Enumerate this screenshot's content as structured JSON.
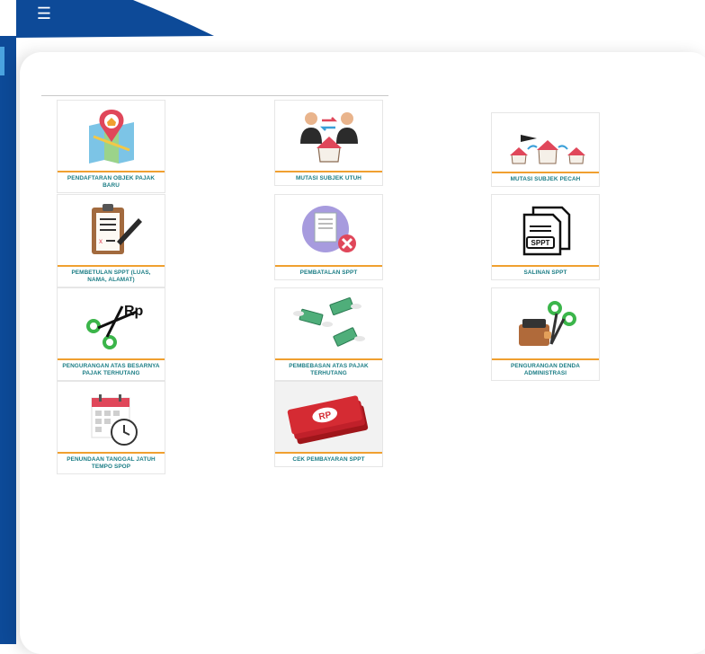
{
  "header": {
    "menu_icon": "hamburger-menu-icon"
  },
  "colors": {
    "sidebar": "#0d4a98",
    "accent": "#f0a030",
    "label_text": "#1b7d85"
  },
  "menu_tiles": [
    {
      "id": "pendaftaran-objek-pajak-baru",
      "label": "PENDAFTARAN OBJEK PAJAK BARU",
      "icon": "map-pin-house-icon"
    },
    {
      "id": "mutasi-subjek-utuh",
      "label": "MUTASI SUBJEK UTUH",
      "icon": "people-exchange-house-icon"
    },
    {
      "id": "mutasi-subjek-pecah",
      "label": "MUTASI SUBJEK PECAH",
      "icon": "houses-split-icon"
    },
    {
      "id": "pembetulan-sppt",
      "label": "PEMBETULAN SPPT (LUAS, NAMA, ALAMAT)",
      "icon": "clipboard-pen-icon"
    },
    {
      "id": "pembatalan-sppt",
      "label": "PEMBATALAN SPPT",
      "icon": "document-cancel-icon"
    },
    {
      "id": "salinan-sppt",
      "label": "SALINAN SPPT",
      "icon": "document-copy-icon",
      "icon_text": "SPPT"
    },
    {
      "id": "pengurangan-atas-besarnya-pajak-terhutang",
      "label": "PENGURANGAN ATAS BESARNYA PAJAK TERHUTANG",
      "icon": "scissors-rp-icon",
      "icon_text": "Rp"
    },
    {
      "id": "pembebasan-atas-pajak-terhutang",
      "label": "PEMBEBASAN ATAS PAJAK TERHUTANG",
      "icon": "flying-money-icon"
    },
    {
      "id": "pengurangan-denda-administrasi",
      "label": "PENGURANGAN DENDA ADMINISTRASI",
      "icon": "wallet-scissors-icon"
    },
    {
      "id": "penundaan-tanggal-jatuh-tempo-spop",
      "label": "PENUNDAAN TANGGAL JATUH TEMPO SPOP",
      "icon": "calendar-clock-icon"
    },
    {
      "id": "cek-pembayaran-sppt",
      "label": "CEK PEMBAYARAN SPPT",
      "icon": "money-banknotes-icon",
      "icon_text": "RP"
    }
  ]
}
